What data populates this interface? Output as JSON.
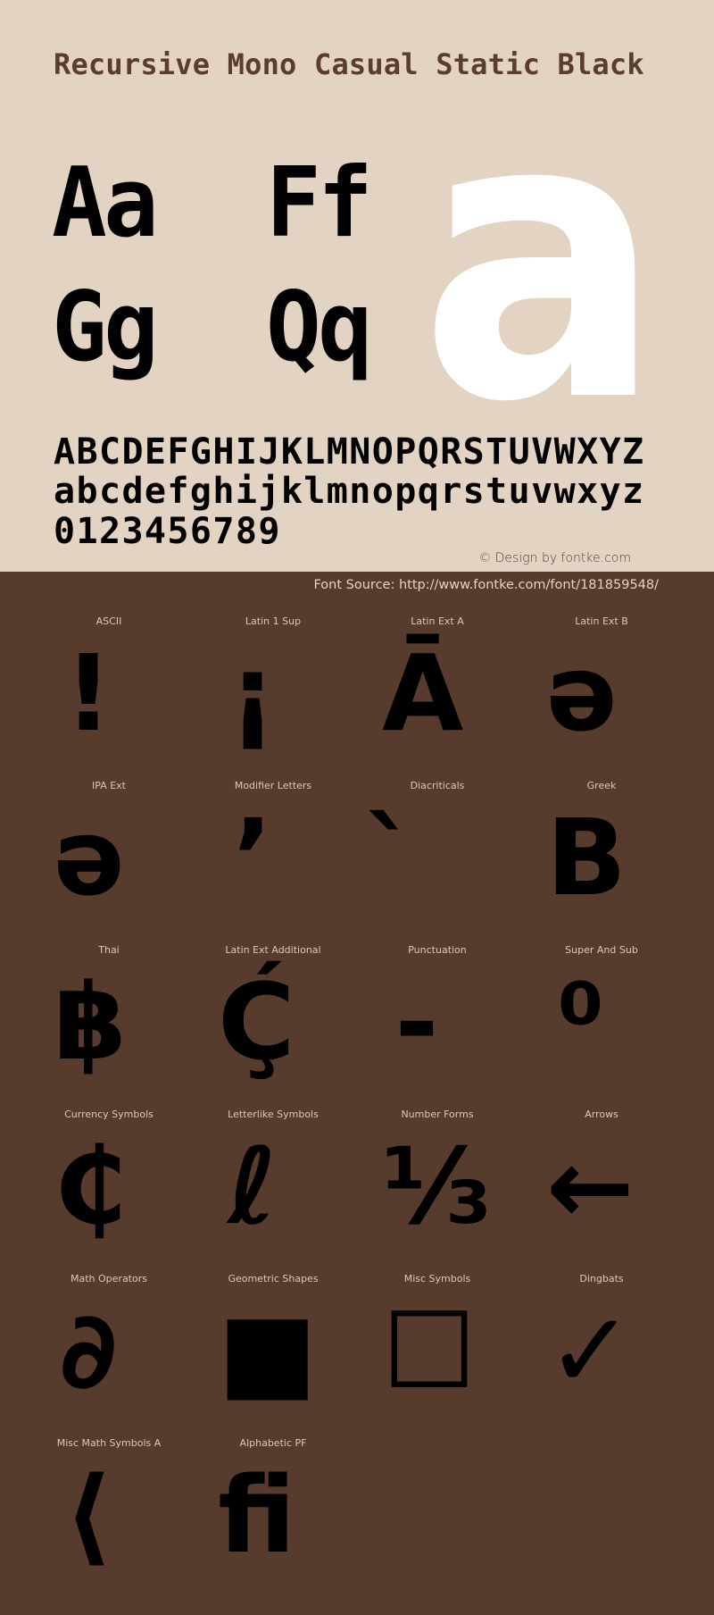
{
  "header": {
    "title": "Recursive Mono Casual Static Black"
  },
  "samples": {
    "pairs": [
      "Aa",
      "Ff",
      "Gg",
      "Qq"
    ],
    "hero_glyph": "a",
    "uppercase": "ABCDEFGHIJKLMNOPQRSTUVWXYZ",
    "lowercase": "abcdefghijklmnopqrstuvwxyz",
    "digits": "0123456789"
  },
  "credit": "© Design by fontke.com",
  "source": "Font Source: http://www.fontke.com/font/181859548/",
  "colors": {
    "top_background": "#e3d3c2",
    "bottom_background": "#573c2d",
    "title": "#5a3d2b",
    "hero_glyph": "#ffffff",
    "glyph": "#000000"
  },
  "blocks": [
    {
      "label": "ASCII",
      "glyph": "!"
    },
    {
      "label": "Latin 1 Sup",
      "glyph": "¡"
    },
    {
      "label": "Latin Ext A",
      "glyph": "Ā"
    },
    {
      "label": "Latin Ext B",
      "glyph": "ǝ"
    },
    {
      "label": "IPA Ext",
      "glyph": "ə"
    },
    {
      "label": "Modifier Letters",
      "glyph": "ʼ"
    },
    {
      "label": "Diacriticals",
      "glyph": "̀"
    },
    {
      "label": "Greek",
      "glyph": "Β"
    },
    {
      "label": "Thai",
      "glyph": "฿"
    },
    {
      "label": "Latin Ext Additional",
      "glyph": "Ḉ"
    },
    {
      "label": "Punctuation",
      "glyph": "‐"
    },
    {
      "label": "Super And Sub",
      "glyph": "⁰"
    },
    {
      "label": "Currency Symbols",
      "glyph": "₵"
    },
    {
      "label": "Letterlike Symbols",
      "glyph": "ℓ"
    },
    {
      "label": "Number Forms",
      "glyph": "⅓"
    },
    {
      "label": "Arrows",
      "glyph": "←"
    },
    {
      "label": "Math Operators",
      "glyph": "∂"
    },
    {
      "label": "Geometric Shapes",
      "glyph": "■"
    },
    {
      "label": "Misc Symbols",
      "glyph": "☐"
    },
    {
      "label": "Dingbats",
      "glyph": "✓"
    },
    {
      "label": "Misc Math Symbols A",
      "glyph": "⟨"
    },
    {
      "label": "Alphabetic PF",
      "glyph": "ﬁ"
    }
  ]
}
